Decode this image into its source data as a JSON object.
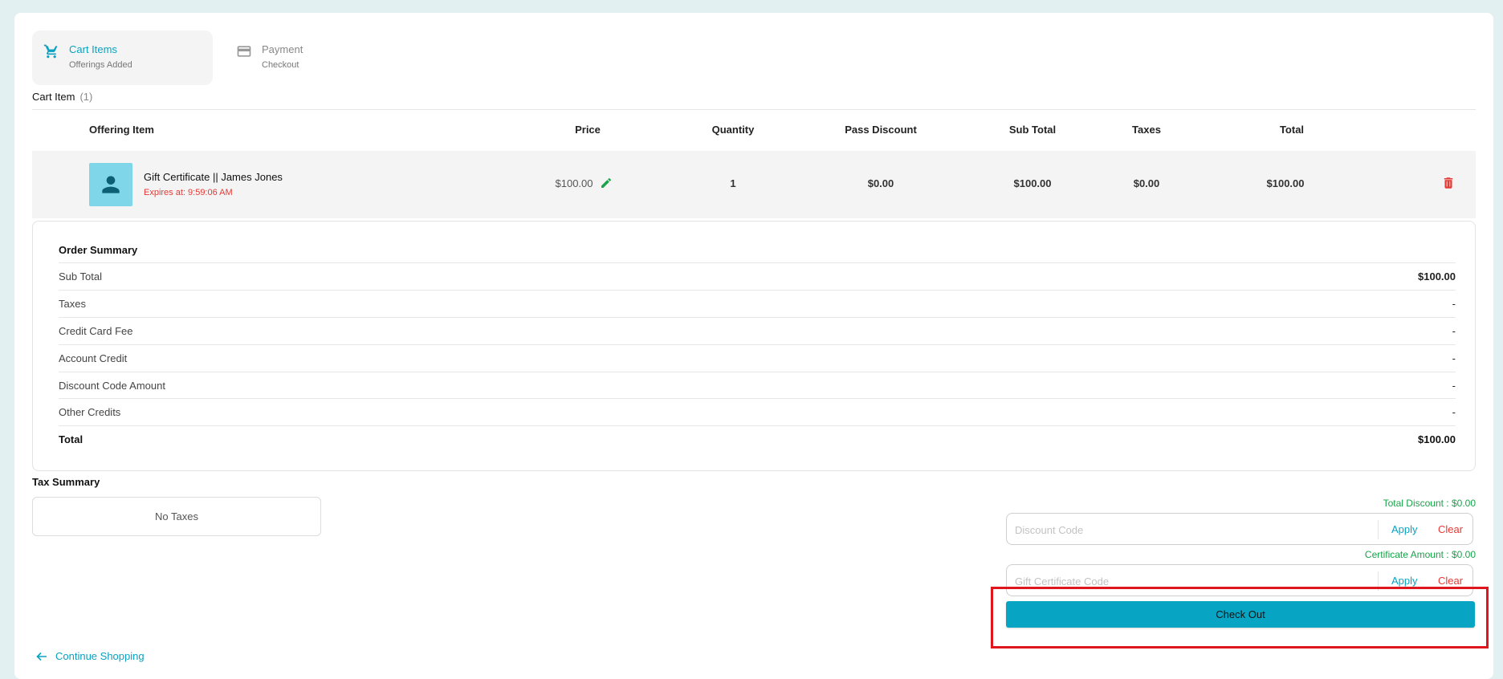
{
  "steps": [
    {
      "title": "Cart Items",
      "subtitle": "Offerings Added"
    },
    {
      "title": "Payment",
      "subtitle": "Checkout"
    }
  ],
  "cart": {
    "heading": "Cart Item",
    "count": "(1)"
  },
  "table": {
    "headers": {
      "offering": "Offering Item",
      "price": "Price",
      "quantity": "Quantity",
      "pass_discount": "Pass Discount",
      "sub_total": "Sub Total",
      "taxes": "Taxes",
      "total": "Total"
    },
    "rows": [
      {
        "name": "Gift Certificate || James Jones",
        "expires": "Expires at: 9:59:06 AM",
        "price": "$100.00",
        "quantity": "1",
        "pass_discount": "$0.00",
        "sub_total": "$100.00",
        "taxes": "$0.00",
        "total": "$100.00"
      }
    ]
  },
  "order_summary": {
    "title": "Order Summary",
    "rows": [
      {
        "label": "Sub Total",
        "value": "$100.00"
      },
      {
        "label": "Taxes",
        "value": "-"
      },
      {
        "label": "Credit Card Fee",
        "value": "-"
      },
      {
        "label": "Account Credit",
        "value": "-"
      },
      {
        "label": "Discount Code Amount",
        "value": "-"
      },
      {
        "label": "Other Credits",
        "value": "-"
      }
    ],
    "total": {
      "label": "Total",
      "value": "$100.00"
    }
  },
  "tax_summary": {
    "title": "Tax Summary",
    "empty": "No Taxes"
  },
  "discount": {
    "total_label": "Total Discount : $0.00",
    "placeholder": "Discount Code",
    "value": "",
    "apply": "Apply",
    "clear": "Clear"
  },
  "certificate": {
    "amount_label": "Certificate Amount : $0.00",
    "placeholder": "Gift Certificate Code",
    "value": "",
    "apply": "Apply",
    "clear": "Clear"
  },
  "checkout": {
    "label": "Check Out"
  },
  "continue_shopping": {
    "label": "Continue Shopping"
  },
  "colors": {
    "accent": "#0aa2c0",
    "checkout_button": "#07a5c3",
    "danger": "#e53935",
    "success": "#1aa34a",
    "highlight_box": "#e0161e"
  },
  "icons": [
    "cart-icon",
    "credit-card-icon",
    "person-icon",
    "pencil-icon",
    "trash-icon",
    "arrow-left-icon"
  ]
}
